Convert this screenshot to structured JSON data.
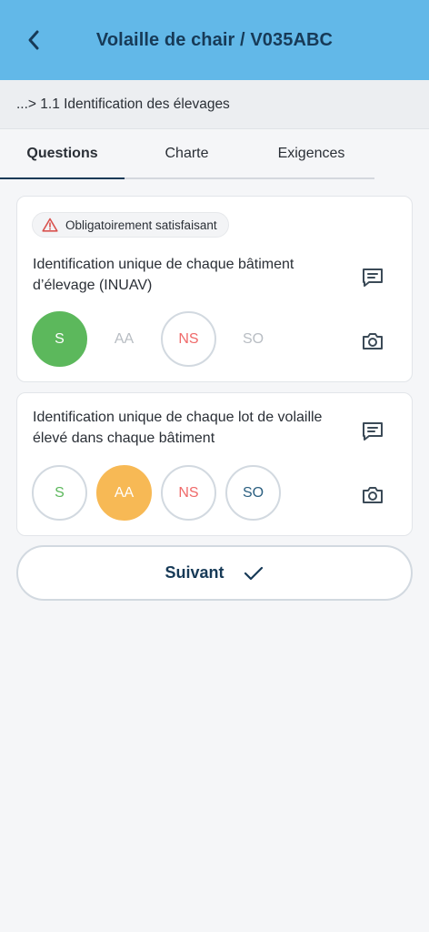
{
  "header": {
    "title": "Volaille de chair / V035ABC",
    "back_icon": "chevron-left-icon"
  },
  "breadcrumb": {
    "text": "...> 1.1 Identification des élevages"
  },
  "tabs": [
    {
      "label": "Questions",
      "active": true
    },
    {
      "label": "Charte",
      "active": false
    },
    {
      "label": "Exigences",
      "active": false
    }
  ],
  "questions": [
    {
      "badge": "Obligatoirement satisfaisant",
      "badge_icon": "warning-triangle-icon",
      "text": "Identification unique de chaque bâtiment d’élevage (INUAV)",
      "answers": [
        {
          "label": "S",
          "selected": true
        },
        {
          "label": "AA",
          "selected": false
        },
        {
          "label": "NS",
          "selected": false
        },
        {
          "label": "SO",
          "selected": false
        }
      ]
    },
    {
      "text": "Identification unique de chaque lot de volaille élevé dans chaque bâtiment",
      "answers": [
        {
          "label": "S",
          "selected": false
        },
        {
          "label": "AA",
          "selected": true
        },
        {
          "label": "NS",
          "selected": false
        },
        {
          "label": "SO",
          "selected": false
        }
      ]
    }
  ],
  "next_button": {
    "label": "Suivant",
    "icon": "check-icon"
  },
  "colors": {
    "header_bg": "#62b8e8",
    "title": "#173a57",
    "satisfaisant": "#5cb85c",
    "a_ameliorer": "#f7b955",
    "non_satisfaisant": "#ef6a6a",
    "sans_objet": "#2b5f80",
    "warning": "#d9534f"
  }
}
